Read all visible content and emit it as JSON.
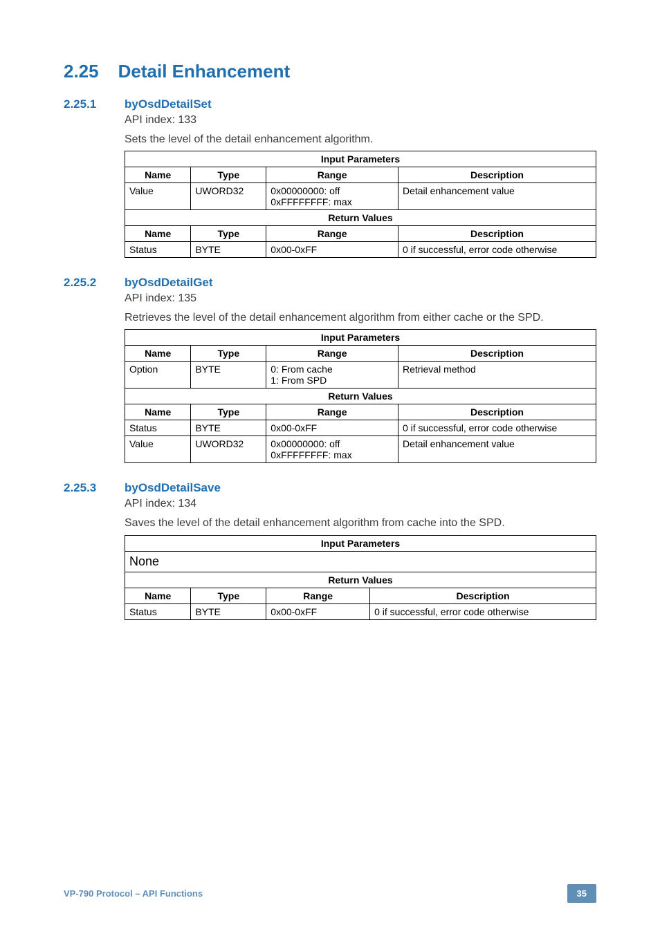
{
  "heading": {
    "num": "2.25",
    "title": "Detail Enhancement"
  },
  "sections": [
    {
      "num": "2.25.1",
      "title": "byOsdDetailSet",
      "api_line": "API index: 133",
      "desc": "Sets the level of the detail enhancement algorithm.",
      "table": {
        "input_header": "Input Parameters",
        "cols": {
          "name": "Name",
          "type": "Type",
          "range": "Range",
          "desc": "Description"
        },
        "input_rows": [
          {
            "name": "Value",
            "type": "UWORD32",
            "range": "0x00000000: off\n0xFFFFFFFF: max",
            "desc": "Detail enhancement value"
          }
        ],
        "return_header": "Return Values",
        "return_rows": [
          {
            "name": "Status",
            "type": "BYTE",
            "range": "0x00-0xFF",
            "desc": "0 if successful, error code otherwise"
          }
        ]
      }
    },
    {
      "num": "2.25.2",
      "title": "byOsdDetailGet",
      "api_line": "API index: 135",
      "desc": "Retrieves the level of the detail enhancement algorithm from either cache or the SPD.",
      "table": {
        "input_header": "Input Parameters",
        "cols": {
          "name": "Name",
          "type": "Type",
          "range": "Range",
          "desc": "Description"
        },
        "input_rows": [
          {
            "name": "Option",
            "type": "BYTE",
            "range": "0: From cache\n1: From SPD",
            "desc": "Retrieval method"
          }
        ],
        "return_header": "Return Values",
        "return_rows": [
          {
            "name": "Status",
            "type": "BYTE",
            "range": "0x00-0xFF",
            "desc": "0 if successful, error code otherwise"
          },
          {
            "name": "Value",
            "type": "UWORD32",
            "range": "0x00000000: off\n0xFFFFFFFF: max",
            "desc": "Detail enhancement value"
          }
        ]
      }
    },
    {
      "num": "2.25.3",
      "title": "byOsdDetailSave",
      "api_line": "API index: 134",
      "desc": "Saves the level of the detail enhancement algorithm from cache into the SPD.",
      "table3": {
        "input_header": "Input Parameters",
        "none_text": "None",
        "return_header": "Return Values",
        "cols": {
          "name": "Name",
          "type": "Type",
          "range": "Range",
          "desc": "Description"
        },
        "return_rows": [
          {
            "name": "Status",
            "type": "BYTE",
            "range": "0x00-0xFF",
            "desc": "0 if successful, error code otherwise"
          }
        ]
      }
    }
  ],
  "footer": {
    "left": "VP-790 Protocol –  API Functions",
    "page": "35"
  }
}
